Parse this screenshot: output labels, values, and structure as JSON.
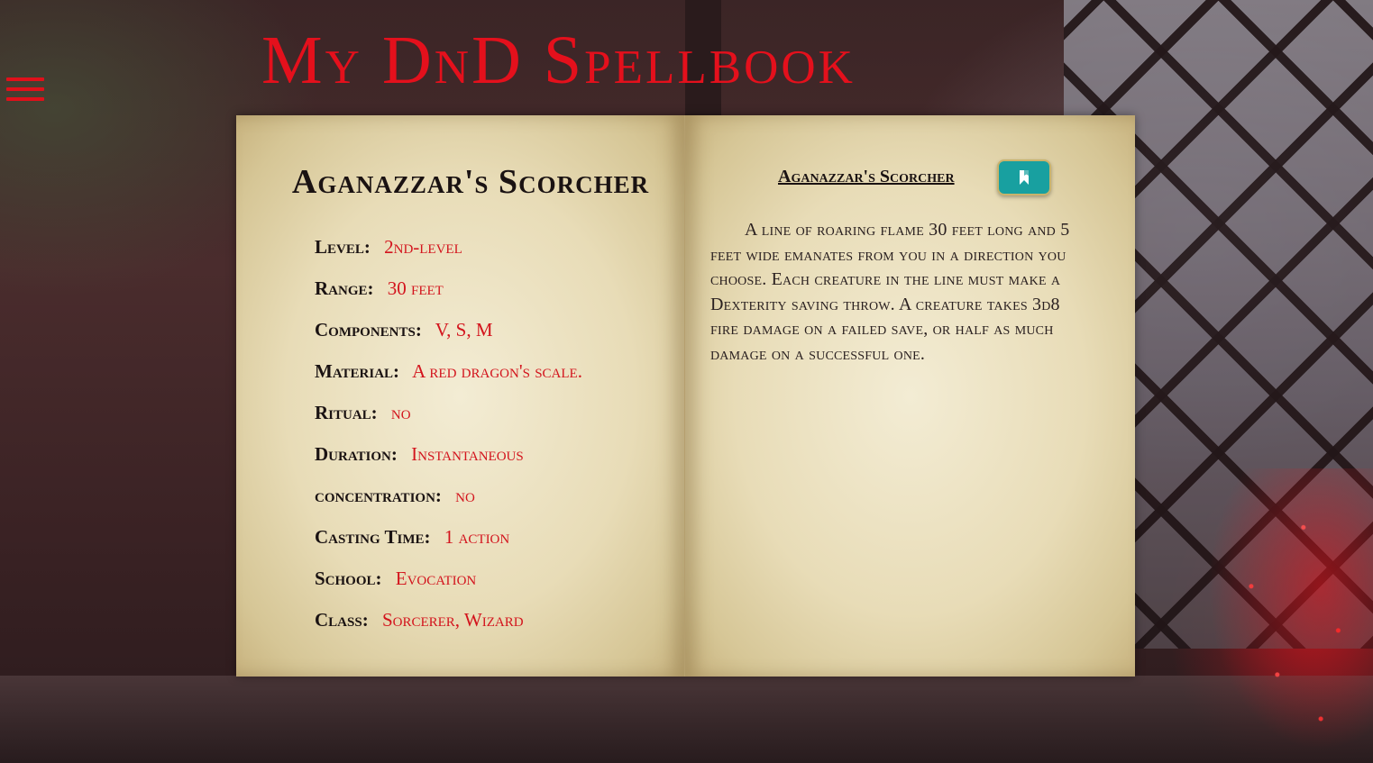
{
  "site": {
    "title": "My DnD Spellbook"
  },
  "spell": {
    "name": "Aganazzar's Scorcher",
    "stats": [
      {
        "label": "Level:",
        "value": "2nd-level"
      },
      {
        "label": "Range:",
        "value": "30 feet"
      },
      {
        "label": "Components:",
        "value": "V, S, M"
      },
      {
        "label": "Material:",
        "value": "A red dragon's scale."
      },
      {
        "label": "Ritual:",
        "value": "no"
      },
      {
        "label": "Duration:",
        "value": "Instantaneous"
      },
      {
        "label": "concentration:",
        "value": "no"
      },
      {
        "label": "Casting Time:",
        "value": "1 action"
      },
      {
        "label": "School:",
        "value": "Evocation"
      },
      {
        "label": "Class:",
        "value": "Sorcerer, Wizard"
      }
    ],
    "description": "A line of roaring flame 30 feet long and 5 feet wide emanates from you in a direction you choose. Each creature in the line must make a Dexterity saving throw. A creature takes 3d8 fire damage on a failed save, or half as much damage on a successful one."
  },
  "icons": {
    "menu": "hamburger-menu-icon",
    "bookmark": "bookmark-icon"
  },
  "colors": {
    "accent_red": "#e4101c",
    "value_red": "#d3141d",
    "button_teal": "#18a0a0"
  }
}
